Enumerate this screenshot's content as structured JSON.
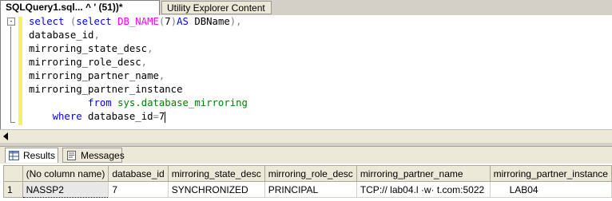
{
  "tabs": [
    {
      "label": "SQLQuery1.sql...   ^ ' (51))*",
      "active": true
    },
    {
      "label": "Utility Explorer Content",
      "active": false
    }
  ],
  "editor": {
    "collapse_glyph": "-",
    "lines": [
      {
        "indent": "",
        "parts": [
          [
            "kw",
            "select"
          ],
          [
            "plain",
            " "
          ],
          [
            "gray",
            "("
          ],
          [
            "kw",
            "select"
          ],
          [
            "plain",
            " "
          ],
          [
            "fn",
            "DB_NAME"
          ],
          [
            "gray",
            "("
          ],
          [
            "plain",
            "7"
          ],
          [
            "gray",
            ")"
          ],
          [
            "kw",
            "AS"
          ],
          [
            "plain",
            " DBName"
          ],
          [
            "gray",
            ")"
          ],
          [
            "gray",
            ","
          ]
        ]
      },
      {
        "indent": "",
        "parts": [
          [
            "plain",
            "database_id"
          ],
          [
            "gray",
            ","
          ]
        ]
      },
      {
        "indent": "",
        "parts": [
          [
            "plain",
            "mirroring_state_desc"
          ],
          [
            "gray",
            ","
          ]
        ]
      },
      {
        "indent": "",
        "parts": [
          [
            "plain",
            "mirroring_role_desc"
          ],
          [
            "gray",
            ","
          ]
        ]
      },
      {
        "indent": "",
        "parts": [
          [
            "plain",
            "mirroring_partner_name"
          ],
          [
            "gray",
            ","
          ]
        ]
      },
      {
        "indent": "",
        "parts": [
          [
            "plain",
            "mirroring_partner_instance"
          ]
        ]
      },
      {
        "indent": "          ",
        "parts": [
          [
            "kw",
            "from"
          ],
          [
            "plain",
            " "
          ],
          [
            "sys",
            "sys.database_mirroring"
          ]
        ]
      },
      {
        "indent": "    ",
        "parts": [
          [
            "kw",
            "where"
          ],
          [
            "plain",
            " database_id"
          ],
          [
            "gray",
            "="
          ],
          [
            "plain",
            "7"
          ]
        ],
        "caret": true
      }
    ]
  },
  "results_tabs": {
    "results": "Results",
    "messages": "Messages"
  },
  "grid": {
    "columns": [
      "(No column name)",
      "database_id",
      "mirroring_state_desc",
      "mirroring_role_desc",
      "mirroring_partner_name",
      "mirroring_partner_instance"
    ],
    "rows": [
      {
        "num": "1",
        "cells": [
          "NASSP2",
          "7",
          "SYNCHRONIZED",
          "PRINCIPAL",
          "TCP://     lab04.l  ·w· t.com:5022",
          "LAB04"
        ]
      }
    ]
  },
  "colors": {
    "keyword": "#0000ff",
    "function": "#ff00ff",
    "system": "#008000",
    "operator": "#808080"
  }
}
